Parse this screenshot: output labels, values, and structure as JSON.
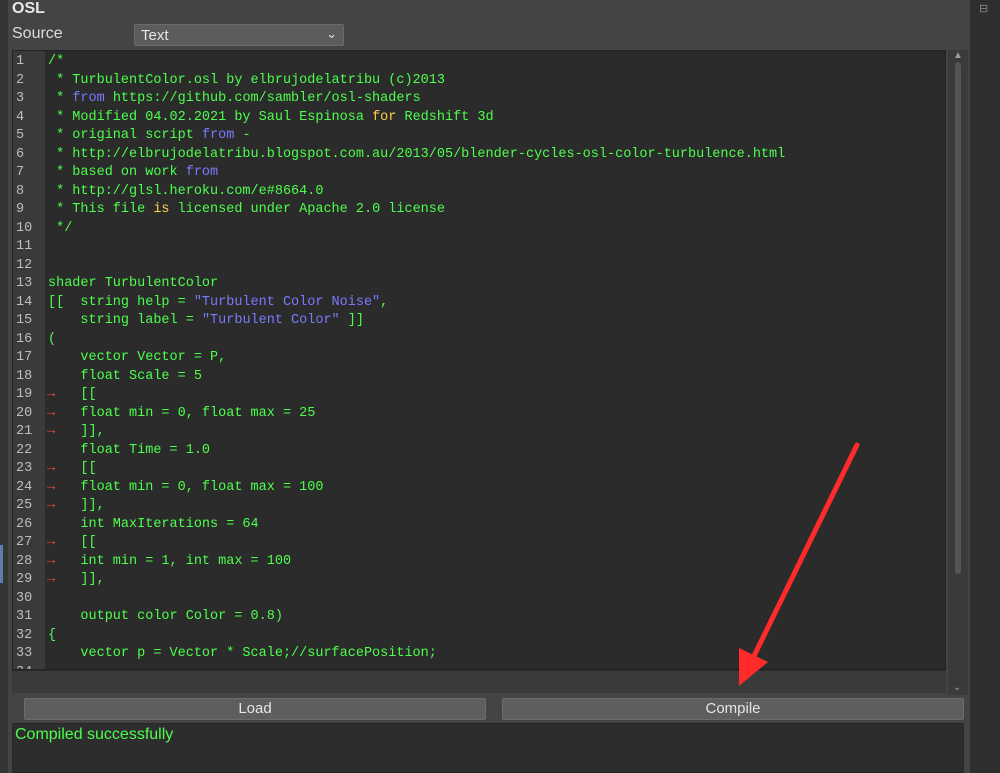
{
  "panel": {
    "title": "OSL",
    "source_label": "Source",
    "source_value": "Text"
  },
  "colors": {
    "comment": "#4cff4c",
    "string": "#7a7aff",
    "keyword": "#ffd24a",
    "arrow": "#ff2a2a"
  },
  "icons": {
    "dropdown": "chevron-down-icon",
    "tab_marker": "tab-arrow-icon"
  },
  "editor": {
    "lines": [
      {
        "n": "1",
        "tab": false,
        "segs": [
          [
            "t",
            "/*"
          ]
        ]
      },
      {
        "n": "2",
        "tab": false,
        "segs": [
          [
            "t",
            " * TurbulentColor.osl by elbrujodelatribu (c)2013"
          ]
        ]
      },
      {
        "n": "3",
        "tab": false,
        "segs": [
          [
            "t",
            " * "
          ],
          [
            "s",
            "from"
          ],
          [
            "t",
            " https://github.com/sambler/osl-shaders"
          ]
        ]
      },
      {
        "n": "4",
        "tab": false,
        "segs": [
          [
            "t",
            " * Modified 04.02.2021 by Saul Espinosa "
          ],
          [
            "k",
            "for"
          ],
          [
            "t",
            " Redshift 3d"
          ]
        ]
      },
      {
        "n": "5",
        "tab": false,
        "segs": [
          [
            "t",
            " * original script "
          ],
          [
            "s",
            "from"
          ],
          [
            "t",
            " -"
          ]
        ]
      },
      {
        "n": "6",
        "tab": false,
        "segs": [
          [
            "t",
            " * http://elbrujodelatribu.blogspot.com.au/2013/05/blender-cycles-osl-color-turbulence.html"
          ]
        ]
      },
      {
        "n": "7",
        "tab": false,
        "segs": [
          [
            "t",
            " * based on work "
          ],
          [
            "s",
            "from"
          ]
        ]
      },
      {
        "n": "8",
        "tab": false,
        "segs": [
          [
            "t",
            " * http://glsl.heroku.com/e#8664.0"
          ]
        ]
      },
      {
        "n": "9",
        "tab": false,
        "segs": [
          [
            "t",
            " * This file "
          ],
          [
            "k",
            "is"
          ],
          [
            "t",
            " licensed under Apache 2.0 license"
          ]
        ]
      },
      {
        "n": "10",
        "tab": false,
        "segs": [
          [
            "t",
            " */"
          ]
        ]
      },
      {
        "n": "11",
        "tab": false,
        "segs": []
      },
      {
        "n": "12",
        "tab": false,
        "segs": []
      },
      {
        "n": "13",
        "tab": false,
        "segs": [
          [
            "t",
            "shader TurbulentColor"
          ]
        ]
      },
      {
        "n": "14",
        "tab": false,
        "segs": [
          [
            "t",
            "[[  string help = "
          ],
          [
            "s",
            "\"Turbulent Color Noise\""
          ],
          [
            "t",
            ","
          ]
        ]
      },
      {
        "n": "15",
        "tab": false,
        "segs": [
          [
            "t",
            "    string label = "
          ],
          [
            "s",
            "\"Turbulent Color\""
          ],
          [
            "t",
            " ]]"
          ]
        ]
      },
      {
        "n": "16",
        "tab": false,
        "segs": [
          [
            "t",
            "("
          ]
        ]
      },
      {
        "n": "17",
        "tab": false,
        "segs": [
          [
            "t",
            "    vector Vector = P,"
          ]
        ]
      },
      {
        "n": "18",
        "tab": false,
        "segs": [
          [
            "t",
            "    float Scale = 5"
          ]
        ]
      },
      {
        "n": "19",
        "tab": true,
        "segs": [
          [
            "t",
            "    [["
          ]
        ]
      },
      {
        "n": "20",
        "tab": true,
        "segs": [
          [
            "t",
            "    float min = 0, float max = 25"
          ]
        ]
      },
      {
        "n": "21",
        "tab": true,
        "segs": [
          [
            "t",
            "    ]],"
          ]
        ]
      },
      {
        "n": "22",
        "tab": false,
        "segs": [
          [
            "t",
            "    float Time = 1.0"
          ]
        ]
      },
      {
        "n": "23",
        "tab": true,
        "segs": [
          [
            "t",
            "    [["
          ]
        ]
      },
      {
        "n": "24",
        "tab": true,
        "segs": [
          [
            "t",
            "    float min = 0, float max = 100"
          ]
        ]
      },
      {
        "n": "25",
        "tab": true,
        "segs": [
          [
            "t",
            "    ]],"
          ]
        ]
      },
      {
        "n": "26",
        "tab": false,
        "segs": [
          [
            "t",
            "    int MaxIterations = 64"
          ]
        ]
      },
      {
        "n": "27",
        "tab": true,
        "segs": [
          [
            "t",
            "    [["
          ]
        ]
      },
      {
        "n": "28",
        "tab": true,
        "segs": [
          [
            "t",
            "    int min = 1, int max = 100"
          ]
        ]
      },
      {
        "n": "29",
        "tab": true,
        "segs": [
          [
            "t",
            "    ]],"
          ]
        ]
      },
      {
        "n": "30",
        "tab": false,
        "segs": []
      },
      {
        "n": "31",
        "tab": false,
        "segs": [
          [
            "t",
            "    output color Color = 0.8)"
          ]
        ]
      },
      {
        "n": "32",
        "tab": false,
        "segs": [
          [
            "t",
            "{"
          ]
        ]
      },
      {
        "n": "33",
        "tab": false,
        "segs": [
          [
            "t",
            "    vector p = Vector * Scale;//surfacePosition;"
          ]
        ]
      },
      {
        "n": "34",
        "tab": false,
        "segs": []
      }
    ]
  },
  "buttons": {
    "load": "Load",
    "compile": "Compile"
  },
  "status": {
    "message": "Compiled successfully"
  }
}
